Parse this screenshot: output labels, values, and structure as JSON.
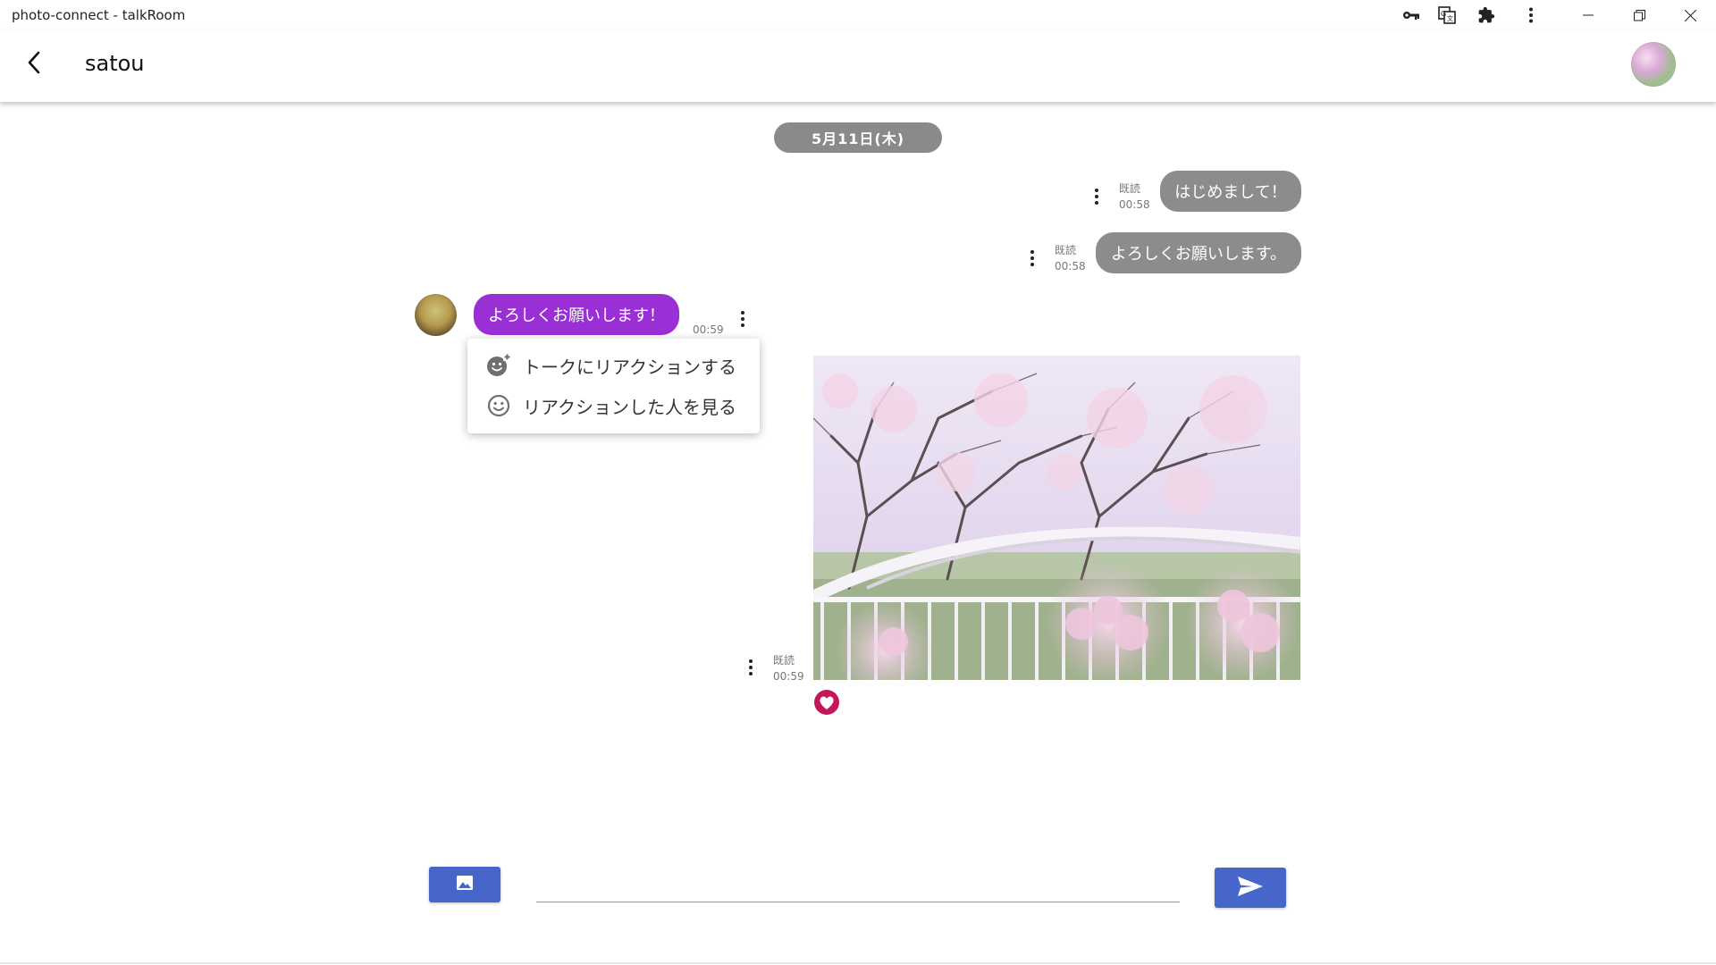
{
  "window": {
    "title": "photo-connect - talkRoom",
    "toolbar_icons": [
      "key-icon",
      "translate-icon",
      "extension-icon",
      "more-vertical-icon"
    ],
    "controls": [
      "minimize",
      "restore",
      "close"
    ]
  },
  "header": {
    "title": "satou",
    "back_icon": "chevron-left-icon",
    "avatar_icon": "user-avatar"
  },
  "date_chip": "5月11日(木)",
  "messages": [
    {
      "side": "sent",
      "text": "はじめまして！",
      "read": "既読",
      "time": "00:58"
    },
    {
      "side": "sent",
      "text": "よろしくお願いします。",
      "read": "既読",
      "time": "00:58"
    },
    {
      "side": "received",
      "text": "よろしくお願いします！",
      "time": "00:59"
    },
    {
      "side": "sent",
      "type": "image",
      "read": "既読",
      "time": "00:59",
      "reaction": "heart-icon"
    }
  ],
  "menu": {
    "items": [
      {
        "label": "トークにリアクションする",
        "icon": "add-reaction-icon"
      },
      {
        "label": "リアクションした人を見る",
        "icon": "smiley-icon"
      }
    ]
  },
  "composer": {
    "image_button_icon": "image-icon",
    "input_value": "",
    "send_button_icon": "send-icon"
  },
  "colors": {
    "sent_bubble": "#8c8c8c",
    "received_bubble": "#9b2fd6",
    "button": "#4766c9",
    "date_chip": "#8a8a8a",
    "reaction": "#c2185b"
  }
}
